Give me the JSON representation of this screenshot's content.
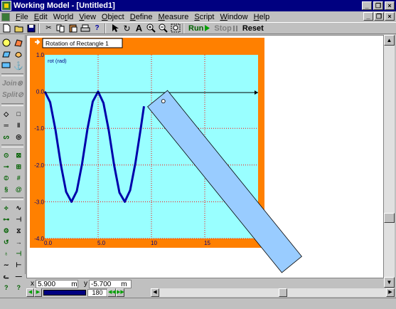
{
  "window": {
    "title": "Working Model - [Untitled1]"
  },
  "menu": [
    {
      "label": "File",
      "ul": "F",
      "rest": "ile"
    },
    {
      "label": "Edit",
      "ul": "E",
      "rest": "dit"
    },
    {
      "label": "World",
      "ul": "",
      "rest": "World"
    },
    {
      "label": "View",
      "ul": "V",
      "rest": "iew"
    },
    {
      "label": "Object",
      "ul": "O",
      "rest": "bject"
    },
    {
      "label": "Define",
      "ul": "D",
      "rest": "efine"
    },
    {
      "label": "Measure",
      "ul": "M",
      "rest": "easure"
    },
    {
      "label": "Script",
      "ul": "S",
      "rest": "cript"
    },
    {
      "label": "Window",
      "ul": "W",
      "rest": "indow"
    },
    {
      "label": "Help",
      "ul": "H",
      "rest": "elp"
    }
  ],
  "toolbar": {
    "run_label": "Run",
    "stop_label": "Stop",
    "reset_label": "Reset"
  },
  "palette": {
    "join_label": "Join",
    "split_label": "Split"
  },
  "meter": {
    "title": "Rotation of Rectangle 1",
    "ylabel": "rot (rad)"
  },
  "coords": {
    "x_label": "x",
    "x_value": "5.900",
    "x_unit": "m",
    "y_label": "y",
    "y_value": "-5.700",
    "y_unit": "m"
  },
  "frame": {
    "value": "180"
  },
  "colors": {
    "meter_border": "#ff8000",
    "plot_bg": "#99ffff",
    "trace": "#0000aa",
    "rectangle": "#99ccff",
    "titlebar": "#000080"
  },
  "chart_data": {
    "type": "line",
    "title": "Rotation of Rectangle 1",
    "ylabel": "rot (rad)",
    "xlim": [
      0,
      20
    ],
    "ylim": [
      -4,
      1
    ],
    "x_ticks": [
      "0.0",
      "5.0",
      "10",
      "15"
    ],
    "y_ticks": [
      "1.0",
      "0.0",
      "-1.0",
      "-2.0",
      "-3.0",
      "-4.0"
    ],
    "grid": true,
    "series": [
      {
        "x": [
          0.0,
          0.5,
          1.0,
          1.5,
          2.0,
          2.5,
          3.0,
          3.5,
          4.0,
          4.5,
          5.0,
          5.5,
          6.0,
          6.5,
          7.0,
          7.5,
          8.0,
          8.5,
          9.0,
          9.3
        ],
        "values": [
          0.0,
          -0.29,
          -1.04,
          -1.98,
          -2.73,
          -3.0,
          -2.71,
          -1.96,
          -1.02,
          -0.27,
          0.0,
          -0.31,
          -1.06,
          -2.0,
          -2.75,
          -3.0,
          -2.69,
          -1.94,
          -1.0,
          -0.4
        ]
      }
    ]
  }
}
